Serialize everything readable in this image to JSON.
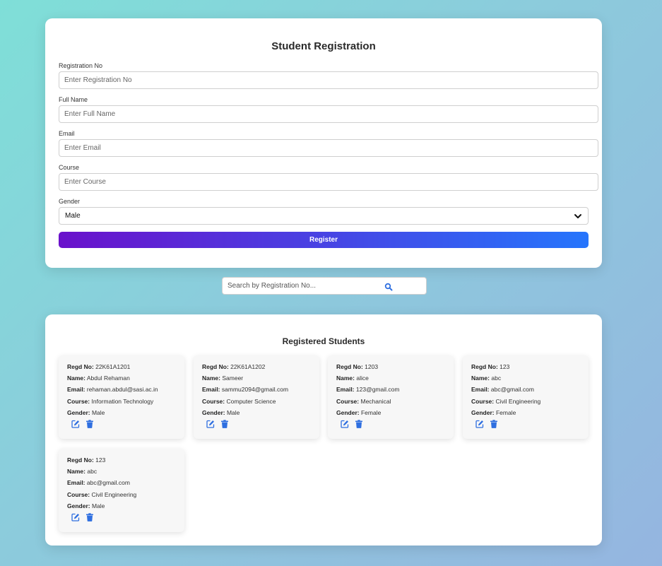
{
  "form": {
    "title": "Student Registration",
    "fields": [
      {
        "label": "Registration No",
        "placeholder": "Enter Registration No",
        "value": ""
      },
      {
        "label": "Full Name",
        "placeholder": "Enter Full Name",
        "value": ""
      },
      {
        "label": "Email",
        "placeholder": "Enter Email",
        "value": ""
      },
      {
        "label": "Course",
        "placeholder": "Enter Course",
        "value": ""
      }
    ],
    "gender_label": "Gender",
    "gender_value": "Male",
    "register_label": "Register"
  },
  "search": {
    "placeholder": "Search by Registration No..."
  },
  "list": {
    "title": "Registered Students",
    "field_labels": {
      "regd": "Regd No:",
      "name": "Name:",
      "email": "Email:",
      "course": "Course:",
      "gender": "Gender:"
    },
    "students": [
      {
        "regd": "22K61A1201",
        "name": "Abdul Rehaman",
        "email": "rehaman.abdul@sasi.ac.in",
        "course": "Information Technology",
        "gender": "Male"
      },
      {
        "regd": "22K61A1202",
        "name": "Sameer",
        "email": "sammu2094@gmail.com",
        "course": "Computer Science",
        "gender": "Male"
      },
      {
        "regd": "1203",
        "name": "alice",
        "email": "123@gmail.com",
        "course": "Mechanical",
        "gender": "Female"
      },
      {
        "regd": "123",
        "name": "abc",
        "email": "abc@gmail.com",
        "course": "Civil Engineering",
        "gender": "Female"
      },
      {
        "regd": "123",
        "name": "abc",
        "email": "abc@gmail.com",
        "course": "Civil Engineering",
        "gender": "Male"
      }
    ]
  },
  "colors": {
    "accent_start": "#6a11cb",
    "accent_end": "#2575fc",
    "icon_blue": "#2f6fe0"
  }
}
